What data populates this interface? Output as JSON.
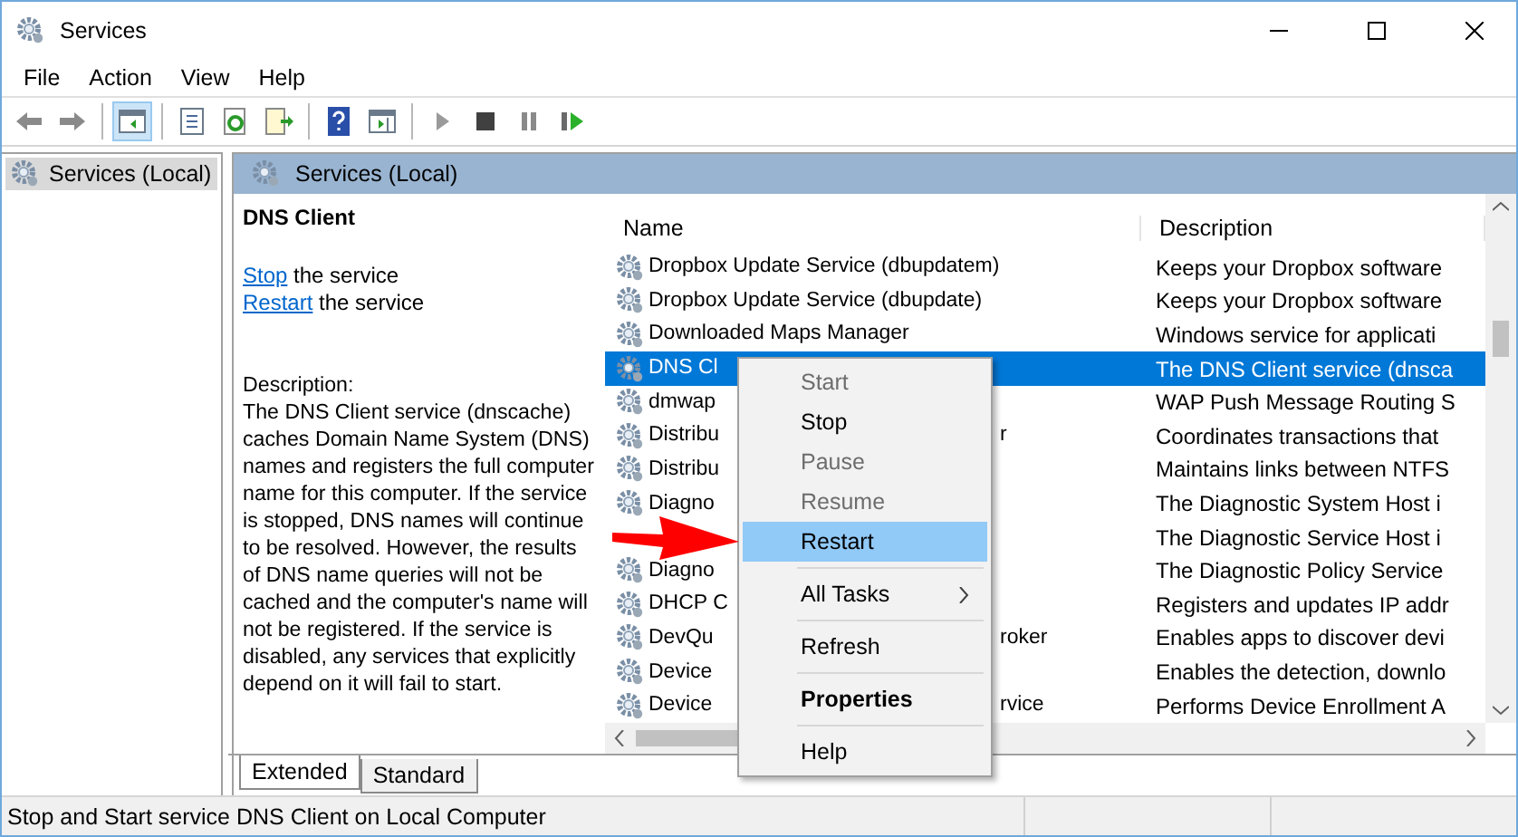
{
  "window": {
    "title": "Services"
  },
  "menu_bar": [
    "File",
    "Action",
    "View",
    "Help"
  ],
  "toolbar": [
    {
      "kind": "back",
      "selected": false
    },
    {
      "kind": "forward",
      "selected": false
    },
    {
      "kind": "separator"
    },
    {
      "kind": "console-tree",
      "selected": true
    },
    {
      "kind": "separator"
    },
    {
      "kind": "properties",
      "selected": false
    },
    {
      "kind": "refresh",
      "selected": false
    },
    {
      "kind": "export",
      "selected": false
    },
    {
      "kind": "separator"
    },
    {
      "kind": "help",
      "selected": false
    },
    {
      "kind": "action-pane",
      "selected": false
    },
    {
      "kind": "separator"
    },
    {
      "kind": "start",
      "selected": false
    },
    {
      "kind": "stop",
      "selected": false
    },
    {
      "kind": "pause",
      "selected": false
    },
    {
      "kind": "resume",
      "selected": false
    }
  ],
  "tree": {
    "items": [
      {
        "label": "Services (Local)",
        "selected": true
      }
    ]
  },
  "pane_header": "Services (Local)",
  "details": {
    "title": "DNS Client",
    "actions": [
      {
        "link": "Stop",
        "text": "the service"
      },
      {
        "link": "Restart",
        "text": "the service"
      }
    ],
    "description_label": "Description:",
    "description": "The DNS Client service (dnscache) caches Domain Name System (DNS) names and registers the full computer name for this computer. If the service is stopped, DNS names will continue to be resolved. However, the results of DNS name queries will not be cached and the computer's name will not be registered. If the service is disabled, any services that explicitly depend on it will fail to start."
  },
  "table": {
    "columns": [
      "Name",
      "Description"
    ],
    "rows": [
      {
        "name": "Dropbox Update Service (dbupdatem)",
        "description": "Keeps your Dropbox software",
        "selected": false
      },
      {
        "name": "Dropbox Update Service (dbupdate)",
        "description": "Keeps your Dropbox software",
        "selected": false
      },
      {
        "name": "Downloaded Maps Manager",
        "description": "Windows service for applicati",
        "selected": false
      },
      {
        "name": "DNS Cl",
        "description": "The DNS Client service (dnsca",
        "selected": true
      },
      {
        "name": "dmwap",
        "description": "WAP Push Message Routing S",
        "selected": false
      },
      {
        "name": "Distribu",
        "name_end": "r",
        "description": "Coordinates transactions that",
        "selected": false
      },
      {
        "name": "Distribu",
        "description": "Maintains links between NTFS",
        "selected": false
      },
      {
        "name": "Diagno",
        "description": "The Diagnostic System Host i",
        "selected": false
      },
      {
        "description": "The Diagnostic Service Host i",
        "selected": false
      },
      {
        "name": "Diagno",
        "description": "The Diagnostic Policy Service",
        "selected": false
      },
      {
        "name": "DHCP C",
        "description": "Registers and updates IP addr",
        "selected": false
      },
      {
        "name": "DevQu",
        "name_end": "roker",
        "description": "Enables apps to discover devi",
        "selected": false
      },
      {
        "name": "Device",
        "description": "Enables the detection, downlo",
        "selected": false
      },
      {
        "name": "Device",
        "name_end": "rvice",
        "description": "Performs Device Enrollment A",
        "selected": false
      }
    ]
  },
  "view_tabs": [
    {
      "label": "Extended",
      "selected": true
    },
    {
      "label": "Standard",
      "selected": false
    }
  ],
  "context_menu": [
    {
      "kind": "item",
      "label": "Start",
      "disabled": true,
      "selected": false,
      "bold": false
    },
    {
      "kind": "item",
      "label": "Stop",
      "disabled": false,
      "selected": false,
      "bold": false
    },
    {
      "kind": "item",
      "label": "Pause",
      "disabled": true,
      "selected": false,
      "bold": false
    },
    {
      "kind": "item",
      "label": "Resume",
      "disabled": true,
      "selected": false,
      "bold": false
    },
    {
      "kind": "item",
      "label": "Restart",
      "disabled": false,
      "selected": true,
      "bold": false
    },
    {
      "kind": "separator"
    },
    {
      "kind": "submenu",
      "label": "All Tasks",
      "disabled": false,
      "selected": false,
      "bold": false
    },
    {
      "kind": "separator"
    },
    {
      "kind": "item",
      "label": "Refresh",
      "disabled": false,
      "selected": false,
      "bold": false
    },
    {
      "kind": "separator"
    },
    {
      "kind": "item",
      "label": "Properties",
      "disabled": false,
      "selected": false,
      "bold": true
    },
    {
      "kind": "separator"
    },
    {
      "kind": "item",
      "label": "Help",
      "disabled": false,
      "selected": false,
      "bold": false
    }
  ],
  "status_bar": "Stop and Start service DNS Client on Local Computer"
}
